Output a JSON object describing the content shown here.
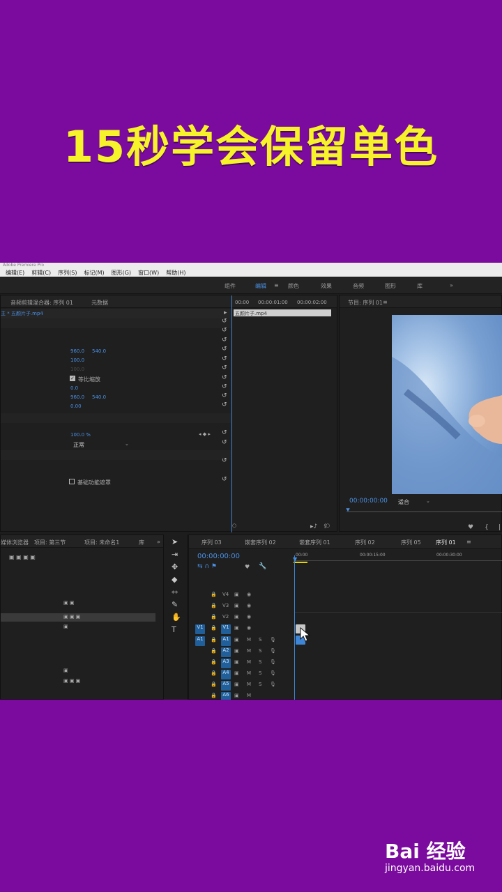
{
  "banner": {
    "title": "15秒学会保留单色"
  },
  "app": {
    "menus": [
      "编辑(E)",
      "剪辑(C)",
      "序列(S)",
      "标记(M)",
      "图形(G)",
      "窗口(W)",
      "帮助(H)"
    ],
    "workspaces": [
      "组件",
      "编辑",
      "颜色",
      "效果",
      "音频",
      "图形",
      "库"
    ],
    "active_workspace": "编辑"
  },
  "effect_controls": {
    "tabs": [
      "音频剪辑混合器: 序列 01",
      "元数据"
    ],
    "clip_name": "主 * 五颜片子.mp4",
    "position": [
      "960.0",
      "540.0"
    ],
    "scale": "100.0",
    "scale_width": "100.0",
    "uniform_scale_label": "等比缩放",
    "rotation": "0.0",
    "anchor": [
      "960.0",
      "540.0"
    ],
    "anti_flicker": "0.00",
    "opacity": "100.0 %",
    "blend_mode": "正常",
    "mask_label": "基础功能遮罩",
    "mini_timeline": {
      "times": [
        "00:00",
        "00:00:01:00",
        "00:00:02:00"
      ],
      "clip_label": "五颜片子.mp4"
    }
  },
  "program_monitor": {
    "title": "节目: 序列 01",
    "timecode": "00:00:00:00",
    "fit": "适合"
  },
  "project": {
    "tabs": [
      "媒体浏览器",
      "项目: 第三节",
      "项目: 未命名1",
      "库"
    ]
  },
  "timeline": {
    "tabs": [
      "序列 03",
      "嵌套序列 02",
      "嵌套序列 01",
      "序列 02",
      "序列 05",
      "序列 01"
    ],
    "active_tab": "序列 01",
    "timecode": "00:00:00:00",
    "ruler": [
      "00:00",
      "00:00:15:00",
      "00:00:30:00"
    ],
    "video_tracks": [
      "V4",
      "V3",
      "V2",
      "V1"
    ],
    "audio_tracks": [
      "A1",
      "A2",
      "A3",
      "A4",
      "A5",
      "A6"
    ],
    "source_v": "V1",
    "source_a": "A1"
  },
  "watermark": {
    "brand": "Bai 经验",
    "url": "jingyan.baidu.com"
  }
}
